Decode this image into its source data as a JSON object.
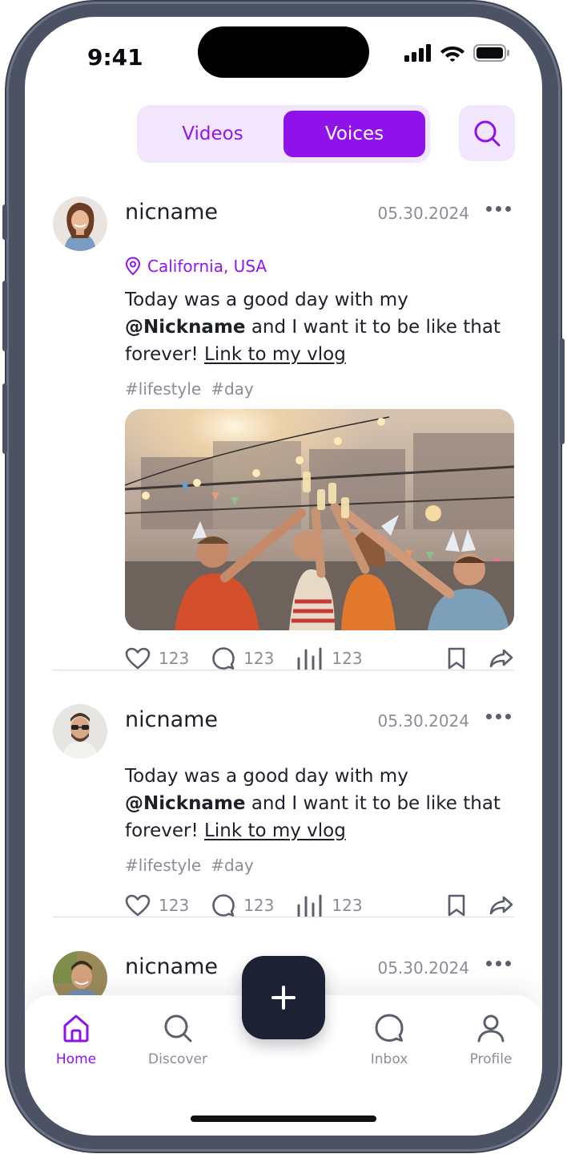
{
  "status": {
    "time": "9:41"
  },
  "tabs": [
    {
      "label": "Videos",
      "active": false
    },
    {
      "label": "Voices",
      "active": true
    }
  ],
  "colors": {
    "accent": "#8f12ea",
    "accent_soft": "#f2e6fd",
    "fab": "#1c2233",
    "muted": "#8b8d97"
  },
  "posts": [
    {
      "username": "nicname",
      "date": "05.30.2024",
      "location": "California, USA",
      "text_before": "Today was a good day with my",
      "mention": "@Nickname",
      "text_after": " and I want it to be like that forever! ",
      "link": "Link to my vlog",
      "tags": [
        "#lifestyle",
        "#day"
      ],
      "likes": "123",
      "comments": "123",
      "views": "123"
    },
    {
      "username": "nicname",
      "date": "05.30.2024",
      "text_before": "Today was a good day with my",
      "mention": "@Nickname",
      "text_after": " and I want it to be like that forever! ",
      "link": "Link to my vlog",
      "tags": [
        "#lifestyle",
        "#day"
      ],
      "likes": "123",
      "comments": "123",
      "views": "123"
    },
    {
      "username": "nicname",
      "date": "05.30.2024"
    }
  ],
  "nav": [
    {
      "label": "Home",
      "icon": "home-icon",
      "active": true
    },
    {
      "label": "Discover",
      "icon": "search-icon",
      "active": false
    },
    {
      "label": "Inbox",
      "icon": "chat-icon",
      "active": false
    },
    {
      "label": "Profile",
      "icon": "user-icon",
      "active": false
    }
  ]
}
